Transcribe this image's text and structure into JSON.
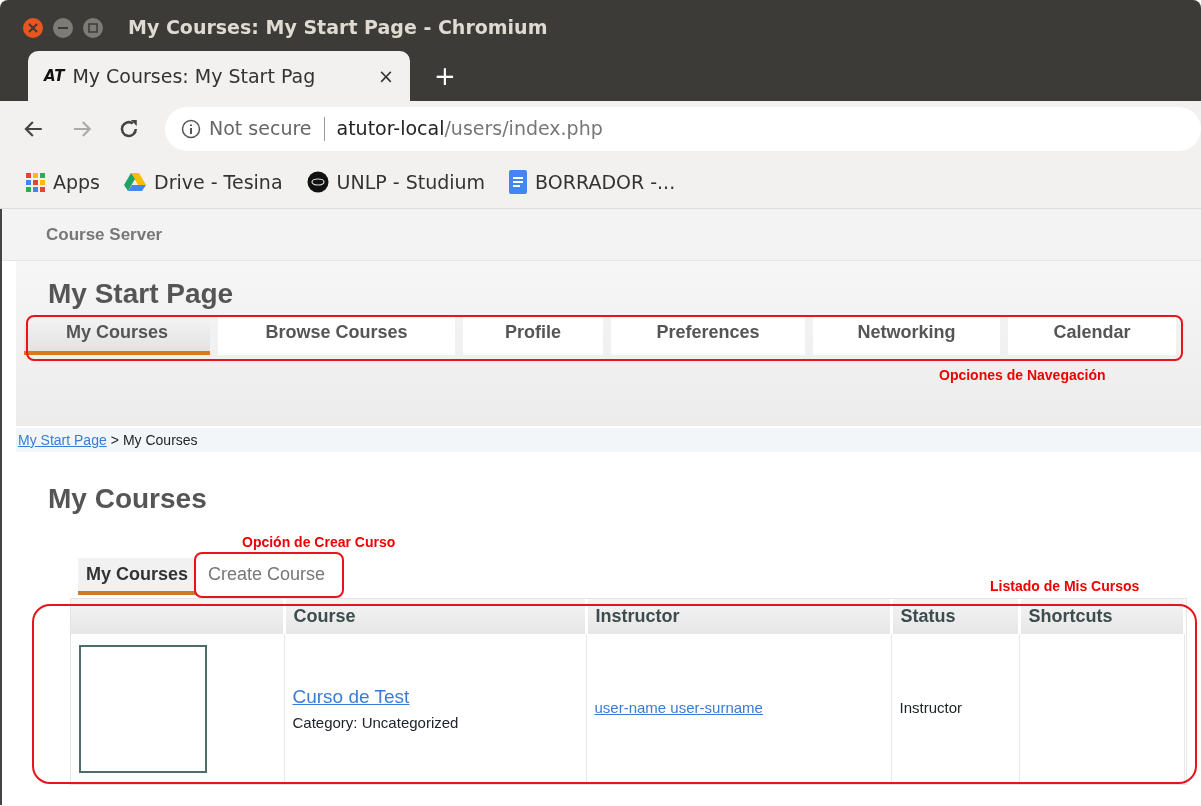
{
  "window": {
    "title": "My Courses: My Start Page - Chromium"
  },
  "browser_tab": {
    "title": "My Courses: My Start Pag",
    "close": "×",
    "favicon": "AT"
  },
  "new_tab": "+",
  "address_bar": {
    "security": "Not secure",
    "host": "atutor-local",
    "path": "/users/index.php"
  },
  "bookmarks": [
    {
      "kind": "apps",
      "label": "Apps"
    },
    {
      "kind": "drive",
      "label": "Drive - Tesina"
    },
    {
      "kind": "disc",
      "label": "UNLP - Studium"
    },
    {
      "kind": "doc",
      "label": "BORRADOR -..."
    }
  ],
  "site_name": "Course Server",
  "page_title": "My Start Page",
  "nav_tabs": [
    {
      "label": "My Courses",
      "selected": true
    },
    {
      "label": "Browse Courses",
      "selected": false
    },
    {
      "label": "Profile",
      "selected": false
    },
    {
      "label": "Preferences",
      "selected": false
    },
    {
      "label": "Networking",
      "selected": false
    },
    {
      "label": "Calendar",
      "selected": false
    }
  ],
  "breadcrumb": {
    "link": "My Start Page",
    "separator": ">",
    "current": "My Courses"
  },
  "section_title": "My Courses",
  "annotations": {
    "navigation": "Opciones de Navegación",
    "create_course": "Opción de Crear Curso",
    "course_list": "Listado de Mis Cursos"
  },
  "subtabs": [
    {
      "label": "My Courses",
      "selected": true
    },
    {
      "label": "Create Course",
      "selected": false
    }
  ],
  "table": {
    "columns": [
      "Course",
      "Instructor",
      "Status",
      "Shortcuts"
    ],
    "rows": [
      {
        "course": "Curso de Test",
        "category": "Category: Uncategorized",
        "instructor": "user-name user-surname",
        "status": "Instructor"
      }
    ]
  }
}
